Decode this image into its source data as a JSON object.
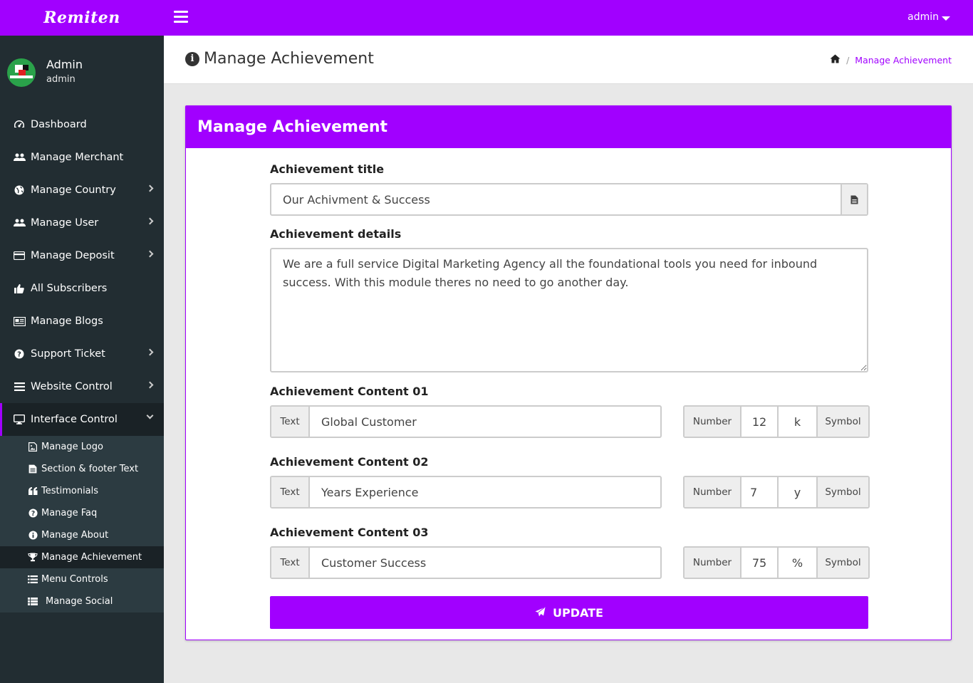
{
  "brand": "Remiten",
  "topbar": {
    "user_label": "admin"
  },
  "profile": {
    "name": "Admin",
    "role": "admin"
  },
  "sidebar": {
    "items": [
      {
        "label": "Dashboard"
      },
      {
        "label": "Manage Merchant"
      },
      {
        "label": "Manage Country"
      },
      {
        "label": "Manage User"
      },
      {
        "label": "Manage Deposit"
      },
      {
        "label": "All Subscribers"
      },
      {
        "label": "Manage Blogs"
      },
      {
        "label": "Support Ticket"
      },
      {
        "label": "Website Control"
      },
      {
        "label": "Interface Control"
      }
    ],
    "submenu": [
      {
        "label": "Manage Logo"
      },
      {
        "label": "Section & footer Text"
      },
      {
        "label": "Testimonials"
      },
      {
        "label": "Manage Faq"
      },
      {
        "label": "Manage About"
      },
      {
        "label": "Manage Achievement"
      },
      {
        "label": "Menu Controls"
      },
      {
        "label": "Manage Social"
      }
    ]
  },
  "header": {
    "title": "Manage Achievement",
    "breadcrumb": "Manage Achievement"
  },
  "card": {
    "title": "Manage Achievement"
  },
  "form": {
    "title_label": "Achievement title",
    "title_value": "Our Achivment & Success",
    "details_label": "Achievement details",
    "details_value": "We are a full service Digital Marketing Agency all the foundational tools you need for inbound success. With this module theres no need to go another day.",
    "text_addon": "Text",
    "number_addon": "Number",
    "symbol_addon": "Symbol",
    "contents": [
      {
        "label": "Achievement Content 01",
        "text": "Global Customer",
        "number": "12",
        "symbol": "k"
      },
      {
        "label": "Achievement Content 02",
        "text": "Years Experience",
        "number": "7",
        "symbol": "y"
      },
      {
        "label": "Achievement Content 03",
        "text": "Customer Success",
        "number": "75",
        "symbol": "%"
      }
    ],
    "update_label": "UPDATE"
  },
  "colors": {
    "accent": "#a100ff",
    "sidebar": "#222d32",
    "submenu": "#2c3b41"
  }
}
